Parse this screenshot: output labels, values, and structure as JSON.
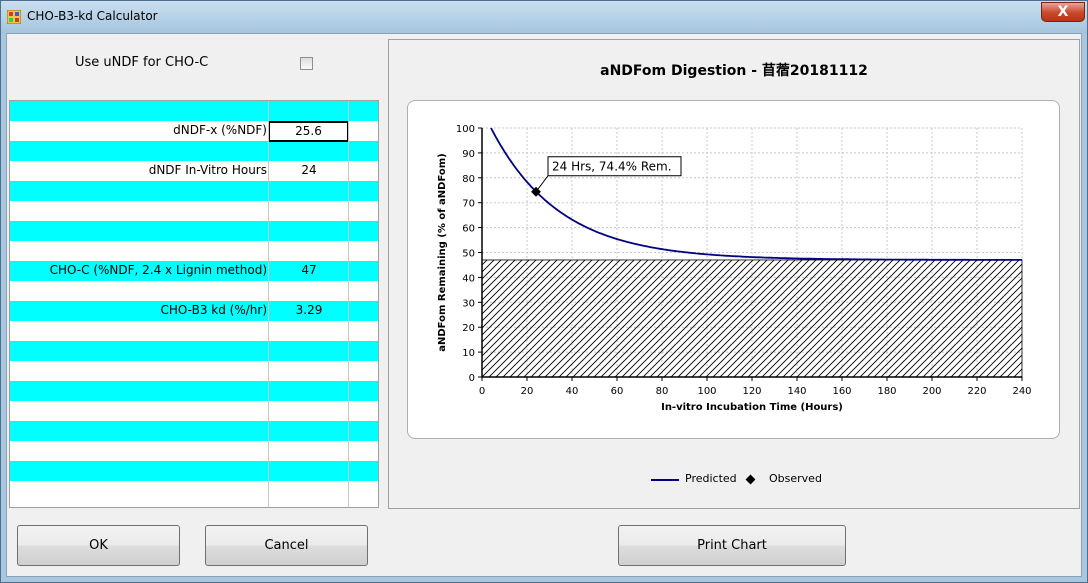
{
  "window": {
    "title": "CHO-B3-kd Calculator",
    "close_glyph": "X"
  },
  "left_panel": {
    "undf_label": "Use uNDF for CHO-C",
    "undf_checked": false,
    "rows": [
      {
        "label": "",
        "value": "",
        "cyan": true
      },
      {
        "label": "dNDF-x (%NDF)",
        "value": "25.6",
        "cyan": false,
        "editing": true
      },
      {
        "label": "",
        "value": "",
        "cyan": true
      },
      {
        "label": "dNDF In-Vitro Hours",
        "value": "24",
        "cyan": false
      },
      {
        "label": "",
        "value": "",
        "cyan": true
      },
      {
        "label": "",
        "value": "",
        "cyan": false
      },
      {
        "label": "",
        "value": "",
        "cyan": true
      },
      {
        "label": "",
        "value": "",
        "cyan": false
      },
      {
        "label": "CHO-C (%NDF, 2.4 x Lignin method)",
        "value": "47",
        "cyan": true
      },
      {
        "label": "",
        "value": "",
        "cyan": false
      },
      {
        "label": "CHO-B3 kd (%/hr)",
        "value": "3.29",
        "cyan": true
      },
      {
        "label": "",
        "value": "",
        "cyan": false
      },
      {
        "label": "",
        "value": "",
        "cyan": true
      },
      {
        "label": "",
        "value": "",
        "cyan": false
      },
      {
        "label": "",
        "value": "",
        "cyan": true
      },
      {
        "label": "",
        "value": "",
        "cyan": false
      },
      {
        "label": "",
        "value": "",
        "cyan": true
      },
      {
        "label": "",
        "value": "",
        "cyan": false
      },
      {
        "label": "",
        "value": "",
        "cyan": true
      },
      {
        "label": "",
        "value": "",
        "cyan": false
      }
    ]
  },
  "chart": {
    "title": "aNDFom Digestion - 苜蓿20181112",
    "annotation": "24 Hrs, 74.4% Rem.",
    "legend": {
      "predicted": "Predicted",
      "observed": "Observed"
    }
  },
  "chart_data": {
    "type": "line",
    "xlabel": "In-vitro Incubation Time (Hours)",
    "ylabel": "aNDFom Remaining (% of aNDFom)",
    "xlim": [
      0,
      240
    ],
    "ylim": [
      0,
      100
    ],
    "xticks": [
      0,
      20,
      40,
      60,
      80,
      100,
      120,
      140,
      160,
      180,
      200,
      220,
      240
    ],
    "yticks": [
      0,
      10,
      20,
      30,
      40,
      50,
      60,
      70,
      80,
      90,
      100
    ],
    "grid": true,
    "lag_hours": 4,
    "undigestible_fraction": 47,
    "kd_percent_per_hour": 3.29,
    "series": [
      {
        "name": "Predicted",
        "x_start": 4,
        "x_end": 240
      },
      {
        "name": "Observed",
        "points": [
          {
            "x": 24,
            "y": 74.4
          }
        ]
      }
    ],
    "colors": {
      "predicted": "#000080",
      "observed": "#000000",
      "hatch": "#000000"
    }
  },
  "buttons": {
    "ok": "OK",
    "cancel": "Cancel",
    "print": "Print Chart"
  }
}
